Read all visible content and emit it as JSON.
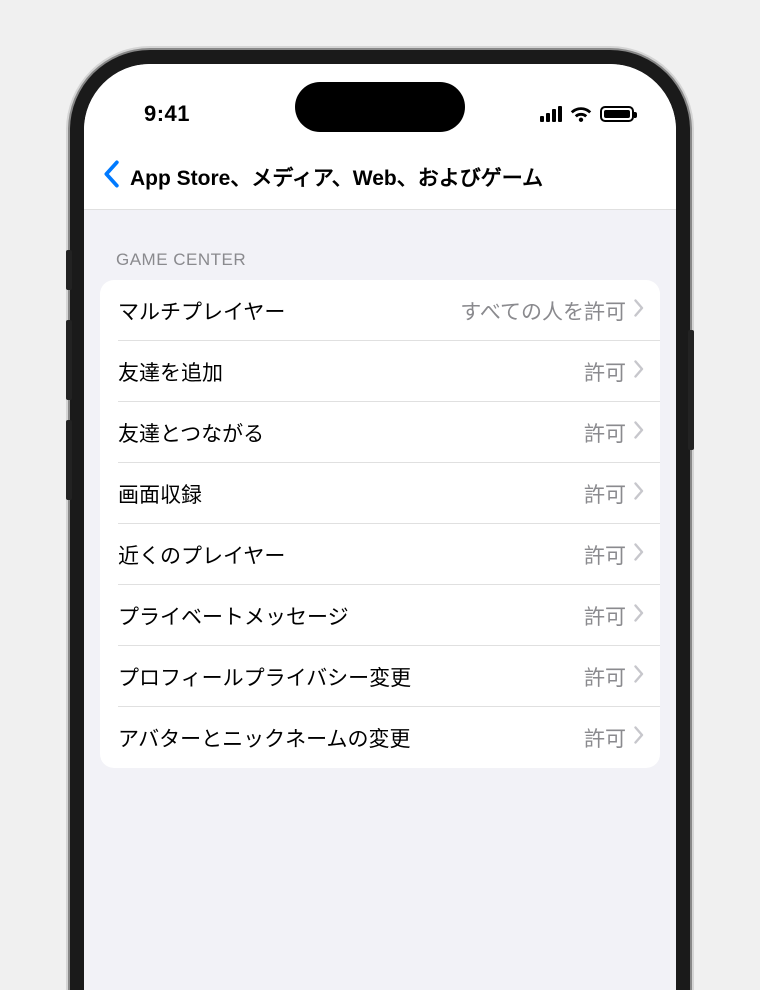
{
  "status_bar": {
    "time": "9:41"
  },
  "nav": {
    "title": "App Store、メディア、Web、およびゲーム"
  },
  "section": {
    "header": "GAME CENTER",
    "rows": [
      {
        "label": "マルチプレイヤー",
        "value": "すべての人を許可"
      },
      {
        "label": "友達を追加",
        "value": "許可"
      },
      {
        "label": "友達とつながる",
        "value": "許可"
      },
      {
        "label": "画面収録",
        "value": "許可"
      },
      {
        "label": "近くのプレイヤー",
        "value": "許可"
      },
      {
        "label": "プライベートメッセージ",
        "value": "許可"
      },
      {
        "label": "プロフィールプライバシー変更",
        "value": "許可"
      },
      {
        "label": "アバターとニックネームの変更",
        "value": "許可"
      }
    ]
  }
}
